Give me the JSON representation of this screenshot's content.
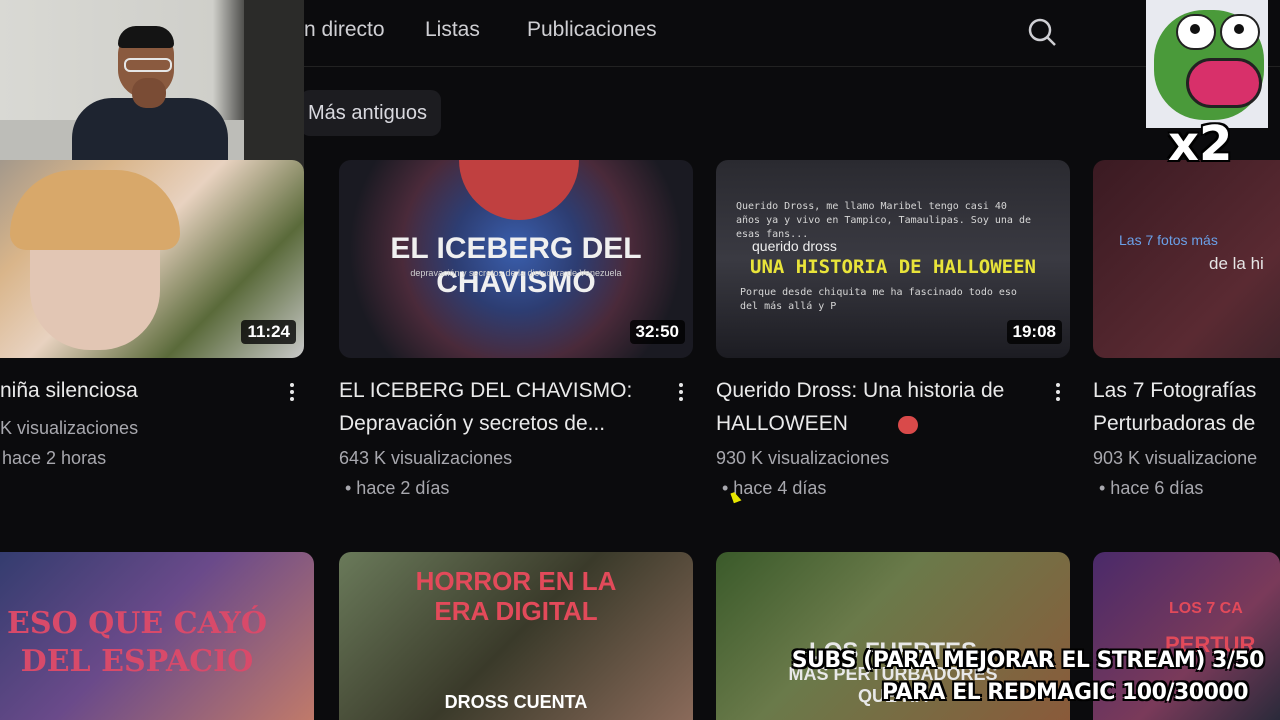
{
  "tabs": [
    "n directo",
    "Listas",
    "Publicaciones"
  ],
  "filter_chip": "Más antiguos",
  "videos": [
    {
      "title": "niña silenciosa",
      "duration": "11:24",
      "views": "K visualizaciones",
      "age": "hace 2 horas"
    },
    {
      "title": "EL ICEBERG DEL CHAVISMO: Depravación y secretos de...",
      "duration": "32:50",
      "views": "643 K visualizaciones",
      "age": "• hace 2 días",
      "thumb_title": "EL ICEBERG DEL CHAVISMO",
      "thumb_sub": "depravación y secretos de la dictadura de Venezuela"
    },
    {
      "title": "Querido Dross: Una historia de HALLOWEEN",
      "duration": "19:08",
      "views": "930 K visualizaciones",
      "age": "• hace 4 días",
      "thumb_small": "Querido Dross, me llamo Maribel tengo casi 40 años ya y vivo en Tampico, Tamaulipas. Soy una de esas fans...",
      "thumb_banner": "UNA HISTORIA DE HALLOWEEN",
      "thumb_tag": "querido dross",
      "thumb_bottom": "Porque desde chiquita me ha fascinado todo eso del más allá y P"
    },
    {
      "title": "Las 7 Fotografías Perturbadoras de",
      "views": "903 K visualizacione",
      "age": "• hace 6 días",
      "thumb_top": "Las 7 fotos más",
      "thumb_mid": "de la hi"
    }
  ],
  "bottom_thumbs": [
    {
      "line1": "ESO QUE CAYÓ",
      "line2": "DEL ESPACIO"
    },
    {
      "line1": "HORROR EN LA",
      "line2": "ERA DIGITAL",
      "line3": "DROSS CUENTA"
    },
    {
      "line1": "LOS FUERTES",
      "line2": "MÁS PERTURBADORES",
      "line3": "QUE HA"
    },
    {
      "line1": "LOS 7 CA",
      "line2": "PERTUR"
    }
  ],
  "overlay": {
    "multiplier": "x2",
    "subs_line": "SUBS (PARA MEJORAR EL STREAM) 3/50",
    "redmagic_line": "PARA EL REDMAGIC 100/30000"
  },
  "colors": {
    "banner_yellow": "#e9e43a",
    "accent_red": "#d93a3a"
  }
}
